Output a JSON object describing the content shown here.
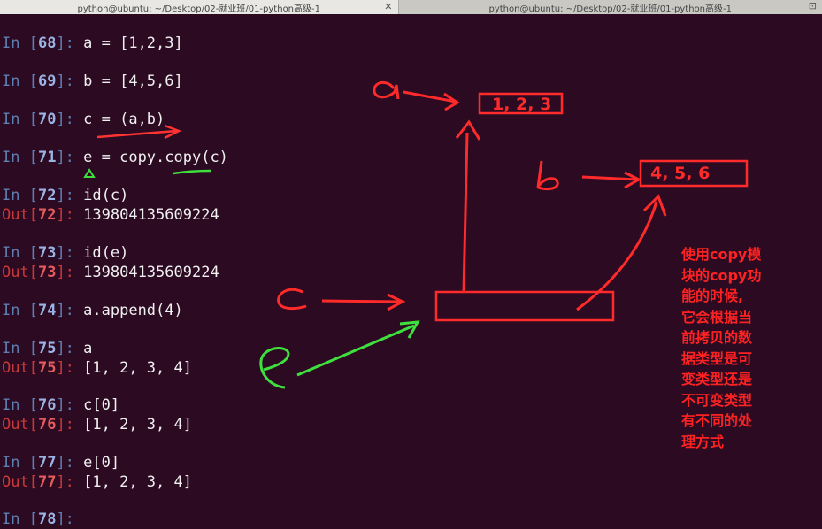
{
  "tabs": [
    {
      "title": "python@ubuntu: ~/Desktop/02-就业班/01-python高级-1",
      "icon": "close-icon"
    },
    {
      "title": "python@ubuntu: ~/Desktop/02-就业班/01-python高级-1",
      "icon": "restore-icon"
    }
  ],
  "terminal": {
    "lines": [
      {
        "kind": "in",
        "n": "68",
        "code": "a = [1,2,3]"
      },
      {
        "kind": "in",
        "n": "69",
        "code": "b = [4,5,6]"
      },
      {
        "kind": "in",
        "n": "70",
        "code": "c = (a,b)"
      },
      {
        "kind": "in",
        "n": "71",
        "code": "e = copy.copy(c)"
      },
      {
        "kind": "in",
        "n": "72",
        "code": "id(c)"
      },
      {
        "kind": "out",
        "n": "72",
        "code": "139804135609224"
      },
      {
        "kind": "in",
        "n": "73",
        "code": "id(e)"
      },
      {
        "kind": "out",
        "n": "73",
        "code": "139804135609224"
      },
      {
        "kind": "in",
        "n": "74",
        "code": "a.append(4)"
      },
      {
        "kind": "in",
        "n": "75",
        "code": "a"
      },
      {
        "kind": "out",
        "n": "75",
        "code": "[1, 2, 3, 4]"
      },
      {
        "kind": "in",
        "n": "76",
        "code": "c[0]"
      },
      {
        "kind": "out",
        "n": "76",
        "code": "[1, 2, 3, 4]"
      },
      {
        "kind": "in",
        "n": "77",
        "code": "e[0]"
      },
      {
        "kind": "out",
        "n": "77",
        "code": "[1, 2, 3, 4]"
      },
      {
        "kind": "in",
        "n": "78",
        "code": ""
      }
    ]
  },
  "annotations": {
    "box_a": "1, 2, 3",
    "box_b": "4, 5, 6",
    "note_lines": [
      "使用copy模",
      "块的copy功",
      "能的时候,",
      "它会根据当",
      "前拷贝的数",
      "据类型是可",
      "变类型还是",
      "不可变类型",
      "有不同的处",
      "理方式"
    ],
    "colors": {
      "red": "#ff2222",
      "green": "#3ee03e"
    }
  }
}
